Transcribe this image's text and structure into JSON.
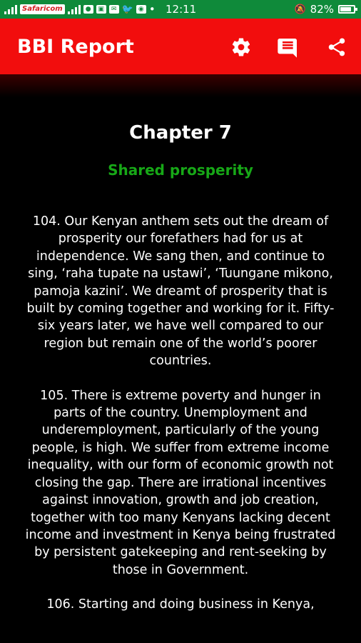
{
  "status_bar": {
    "carrier": "Safaricom",
    "time": "12:11",
    "battery_percent": "82%",
    "battery_level": 0.82
  },
  "app_bar": {
    "title": "BBI Report",
    "actions": [
      "settings-icon",
      "comment-icon",
      "share-icon"
    ]
  },
  "chapter": {
    "title": "Chapter 7",
    "subtitle": "Shared prosperity",
    "paragraphs": [
      "104. Our Kenyan anthem sets out the dream of prosperity our forefathers had for us at independence. We sang then, and continue to sing, ‘raha tupate na ustawi’, ‘Tuungane mikono, pamoja kazini’. We dreamt of prosperity that is built by coming together and working for it. Fifty-six years later, we have well compared to our region but remain one of the world’s poorer countries.",
      "105. There is extreme poverty and hunger in parts of the country. Unemployment and underemployment, particularly of the young people, is high. We suffer from extreme income inequality, with our form of economic growth not closing the gap. There are irrational incentives against innovation, growth and job creation, together with too many Kenyans lacking decent income and investment in Kenya being frustrated by persistent gatekeeping and rent-seeking by those in Government.",
      "106. Starting and doing business in Kenya,"
    ]
  },
  "colors": {
    "status_bar": "#0f8a3a",
    "app_bar": "#f20d0d",
    "background": "#000000",
    "subtitle": "#17a817"
  }
}
